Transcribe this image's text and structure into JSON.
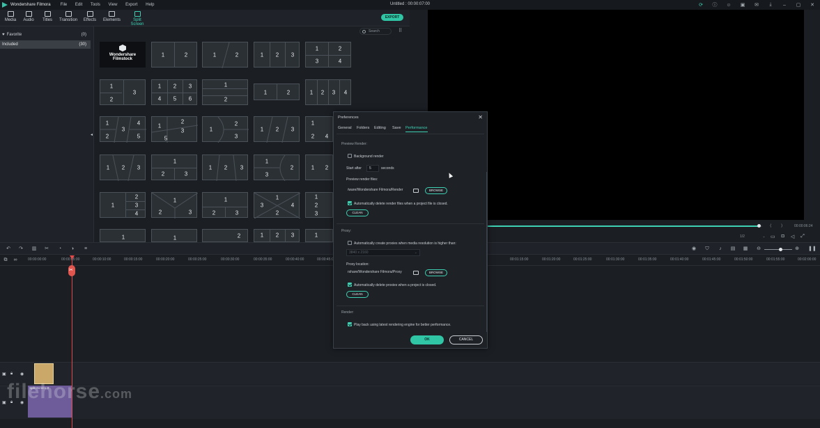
{
  "app": {
    "name": "Wondershare Filmora",
    "title": "Untitled : 00:00:07:00",
    "menu": [
      "File",
      "Edit",
      "Tools",
      "View",
      "Export",
      "Help"
    ]
  },
  "toolbar": {
    "items": [
      {
        "label": "Media",
        "icon": "media-icon"
      },
      {
        "label": "Audio",
        "icon": "audio-icon"
      },
      {
        "label": "Titles",
        "icon": "titles-icon"
      },
      {
        "label": "Transition",
        "icon": "transition-icon"
      },
      {
        "label": "Effects",
        "icon": "effects-icon"
      },
      {
        "label": "Elements",
        "icon": "elements-icon"
      },
      {
        "label": "Split Screen",
        "icon": "split-screen-icon",
        "active": true
      }
    ],
    "export_label": "EXPORT"
  },
  "sidebar": {
    "favorite": {
      "label": "Favorite",
      "count": "(0)"
    },
    "included": {
      "label": "Included",
      "count": "(30)"
    }
  },
  "library": {
    "search_placeholder": "Search",
    "brand_tile": {
      "line1": "Wondershare",
      "line2": "Filmstock"
    },
    "tile_labels": [
      "1",
      "2",
      "3",
      "4",
      "5",
      "6"
    ]
  },
  "preview": {
    "time": "00:00:06:24",
    "ratio": "1/2",
    "progress": 0.99
  },
  "timeline": {
    "ticks": [
      "00:00:00:00",
      "00:00:05:00",
      "00:00:10:00",
      "00:00:15:00",
      "00:00:20:00",
      "00:00:25:00",
      "00:00:30:00",
      "00:00:35:00",
      "00:00:40:00",
      "00:00:45:00",
      "00:01:10:00",
      "00:01:15:00",
      "00:01:20:00",
      "00:01:25:00",
      "00:01:30:00",
      "00:01:35:00",
      "00:01:40:00",
      "00:01:45:00",
      "00:01:50:00",
      "00:01:55:00",
      "00:02:00:00"
    ],
    "clip_label": "Split Screen 3"
  },
  "watermark": {
    "main": "filehorse",
    "suffix": ".com"
  },
  "dialog": {
    "title": "Preferences",
    "tabs": [
      "General",
      "Folders",
      "Editing",
      "Save",
      "Performance"
    ],
    "active_tab": "Performance",
    "preview_render": {
      "section": "Preview Render:",
      "background_render": "Background render",
      "background_render_checked": false,
      "start_after_prefix": "Start after",
      "start_after_value": "5",
      "start_after_suffix": "seconds",
      "files_label": "Preview render files:",
      "files_path": "/ware/Wondershare Filmora/Render",
      "browse": "BROWSE",
      "auto_delete": "Automatically delete render files when a project file is closed.",
      "auto_delete_checked": true,
      "clean": "CLEAN"
    },
    "proxy": {
      "section": "Proxy:",
      "auto_create": "Automatically create proxies when media resolution is higher than:",
      "auto_create_checked": false,
      "resolution": "3840 x 2160",
      "location_label": "Proxy location:",
      "location_path": "rshare/Wondershare Filmora/Proxy",
      "browse": "BROWSE",
      "auto_delete": "Automatically delete proxies when a project is closed.",
      "auto_delete_checked": true,
      "clean": "CLEAN"
    },
    "render": {
      "section": "Render:",
      "playback": "Play back using latest rendering engine for better performance.",
      "playback_checked": true
    },
    "ok": "OK",
    "cancel": "CANCEL"
  }
}
